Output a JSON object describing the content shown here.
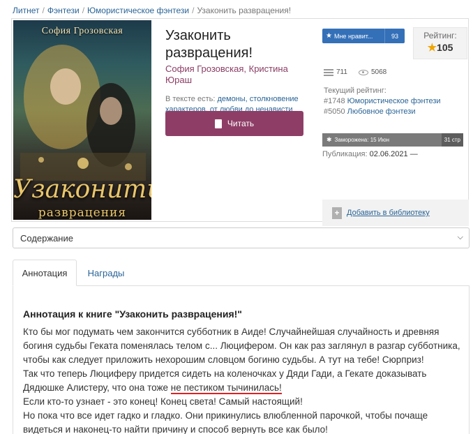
{
  "breadcrumb": {
    "items": [
      "Литнет",
      "Фэнтези",
      "Юмористическое фэнтези",
      "Узаконить разврацения!"
    ],
    "separator": "/"
  },
  "cover": {
    "author": "София Грозовская",
    "title_line1": "Узаконить",
    "title_line2": "разврацения"
  },
  "book": {
    "title_line1": "Узаконить",
    "title_line2": "разврацения!",
    "authors_line1": "София Грозовская, Кристина",
    "authors_line2": "Юраш",
    "tags_label": "В тексте есть:",
    "tags": "демоны, столкновение характеров, от любви до ненависти",
    "read_button": "Читать",
    "read_button_color": "#8e3e66"
  },
  "side": {
    "like_label": "Мне нравит...",
    "like_count": "93",
    "rating_label": "Рейтинг:",
    "rating_value": "105",
    "library_count": "711",
    "views_count": "5068",
    "current_rating_label": "Текущий рейтинг:",
    "rank1_num": "#1748",
    "rank1_genre": "Юмористическое фэнтези",
    "rank2_num": "#5050",
    "rank2_genre": "Любовное фэнтези",
    "frozen_label": "Заморожена: 15 Июн",
    "pages_label": "31 стр",
    "pub_label": "Публикация:",
    "pub_value": "02.06.2021 —",
    "add_library": "Добавить в библиотеку",
    "accent_color": "#3470b8"
  },
  "contents": {
    "selected": "Содержание"
  },
  "tabs": {
    "annotation": "Аннотация",
    "awards": "Награды"
  },
  "annotation": {
    "heading": "Аннотация к книге \"Узаконить разврацения!\"",
    "p1": "Кто бы мог подумать чем закончится субботник в Аиде! Случайнейшая случайность и древняя богиня судьбы Геката поменялась телом с... Люцифером. Он как раз заглянул в разгар субботника, чтобы как следует приложить нехорошим словцом богиню судьбы. А тут на тебе! Сюрприз!",
    "p2_before": "Так что теперь Люциферу придется сидеть на коленочках у Дяди Гади, а Гекате доказывать Дядюшке Алистеру, что она тоже ",
    "p2_marked": "не пестиком тычинилась!",
    "p3": "Если кто-то узнает - это конец! Конец света! Самый настоящий!",
    "p4": "Но пока что все идет гадко и гладко. Они прикинулись влюбленной парочкой, чтобы почаще видеться и наконец-то найти причину и способ вернуть все как было!"
  }
}
